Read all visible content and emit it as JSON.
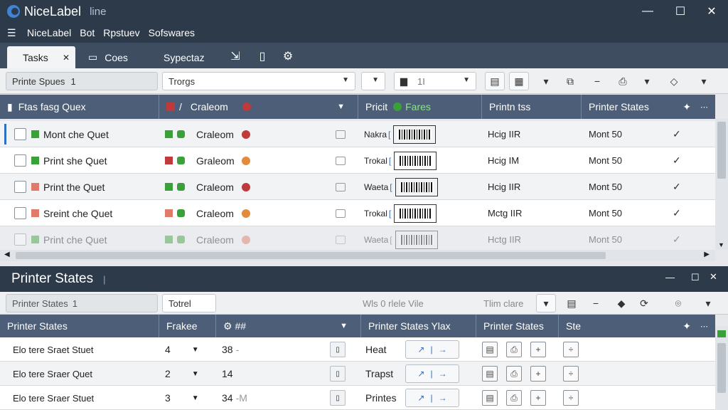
{
  "app": {
    "title": "NiceLabel",
    "subtitle": "line"
  },
  "window_controls": {
    "minimize": "—",
    "maximize": "☐",
    "close": "✕"
  },
  "menu": {
    "items": [
      "NiceLabel",
      "Bot",
      "Rpstuev",
      "Sofswares"
    ]
  },
  "tabs": {
    "active_label": "Tasks",
    "close": "✕",
    "second_label": "Coes",
    "third_label": "Sypectaz"
  },
  "toolbar": {
    "field1": "Printe Spues",
    "field1_suffix": "1",
    "field2": "Trorgs",
    "field3": "1I"
  },
  "grid": {
    "headers": [
      "Ftas fasg Quex",
      "Craleom",
      "Pricit",
      "Fares",
      "Printn tss",
      "Printer States"
    ],
    "rows": [
      {
        "name": "Mont che Quet",
        "type": "Craleom",
        "label": "Nakra",
        "time": "Hcig IIR",
        "state": "Mont 50",
        "color": "#3aa13a",
        "type_sq": "#3aa13a",
        "dot": "#c0393b",
        "faded": false,
        "selected": true
      },
      {
        "name": "Print she Quet",
        "type": "Graleom",
        "label": "Trokal",
        "time": "Hcig IM",
        "state": "Mont 50",
        "color": "#3aa13a",
        "type_sq": "#c0393b",
        "dot": "#e38a3c",
        "faded": false,
        "selected": false
      },
      {
        "name": "Print the Quet",
        "type": "Craleom",
        "label": "Waeta",
        "time": "Hcig IIR",
        "state": "Mont 50",
        "color": "#e07a6a",
        "type_sq": "#3aa13a",
        "dot": "#c0393b",
        "faded": false,
        "selected": false
      },
      {
        "name": "Sreint che Quet",
        "type": "Craleom",
        "label": "Trokal",
        "time": "Mctg IIR",
        "state": "Mont 50",
        "color": "#e07a6a",
        "type_sq": "#e07a6a",
        "dot": "#e38a3c",
        "faded": false,
        "selected": false
      },
      {
        "name": "Print che Quet",
        "type": "Craleom",
        "label": "Waeta",
        "time": "Hctg IIR",
        "state": "Mont 50",
        "color": "#3aa13a",
        "type_sq": "#3aa13a",
        "dot": "#e07a6a",
        "faded": true,
        "selected": false
      }
    ]
  },
  "panel": {
    "title": "Printer States",
    "toolbar": {
      "field1": "Printer States",
      "field1_suffix": "1",
      "field2": "Totrel",
      "text1": "Wls 0 rlele Vile",
      "text2": "Tlim clare"
    },
    "headers": [
      "Printer States",
      "Frakee",
      "⚙ ##",
      "Printer States Ylax",
      "Printer States",
      "Ste"
    ],
    "rows": [
      {
        "name": "Elo tere Sraet Stuet",
        "count": "4",
        "value": "38",
        "value_suffix": "-",
        "mode": "Heat"
      },
      {
        "name": "Elo tere Sraer Quet",
        "count": "2",
        "value": "14",
        "value_suffix": "",
        "mode": "Trapst"
      },
      {
        "name": "Elo tere Sraer Stuet",
        "count": "3",
        "value": "34",
        "value_suffix": "-M",
        "mode": "Printes"
      }
    ]
  },
  "colors": {
    "titlebar": "#2d3a4a",
    "header": "#4c5e78",
    "accent": "#2f6fc3"
  }
}
